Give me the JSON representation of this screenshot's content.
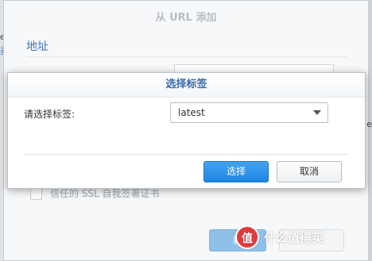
{
  "background_dialog": {
    "title": "从 URL 添加",
    "section": "地址",
    "checkbox_label": "信任的 SSL 自我签署证书",
    "add_button_partial": "新",
    "left_fragment_1": "e",
    "left_fragment_2": "麦",
    "right_fragment": "e"
  },
  "modal": {
    "title": "选择标签",
    "field_label": "请选择标签:",
    "selected_tag": "latest",
    "ok_label": "选择",
    "cancel_label": "取消"
  },
  "watermark": {
    "badge": "值",
    "text": "什么值得买"
  }
}
